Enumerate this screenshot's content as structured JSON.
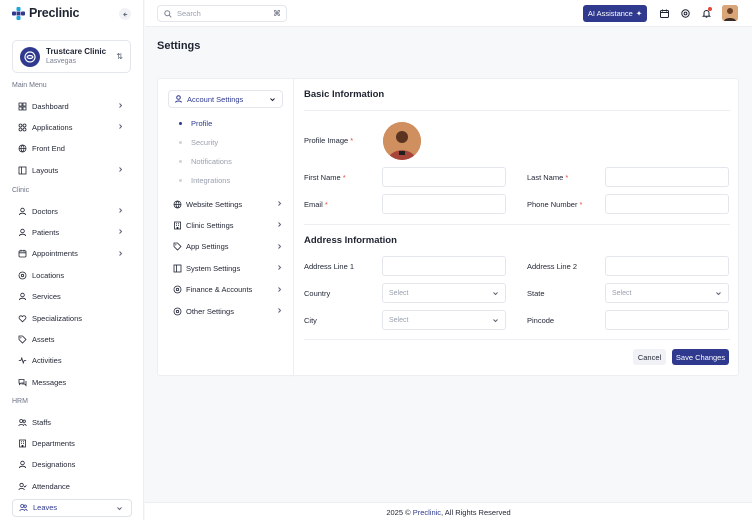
{
  "brand": {
    "name": "Preclinic",
    "primary_color": "#2f3a8f",
    "accent_color": "#1aa7e0"
  },
  "clinic": {
    "name": "Trustcare Clinic",
    "location": "Lasvegas"
  },
  "sidebar": {
    "sections": [
      {
        "title": "Main Menu",
        "items": [
          {
            "label": "Dashboard",
            "icon": "grid-icon",
            "has_children": true
          },
          {
            "label": "Applications",
            "icon": "apps-icon",
            "has_children": true
          },
          {
            "label": "Front End",
            "icon": "globe-icon",
            "has_children": false
          },
          {
            "label": "Layouts",
            "icon": "layout-icon",
            "has_children": true
          }
        ]
      },
      {
        "title": "Clinic",
        "items": [
          {
            "label": "Doctors",
            "icon": "user-icon",
            "has_children": true
          },
          {
            "label": "Patients",
            "icon": "user-icon",
            "has_children": true
          },
          {
            "label": "Appointments",
            "icon": "calendar-icon",
            "has_children": true
          },
          {
            "label": "Locations",
            "icon": "location-icon",
            "has_children": false
          },
          {
            "label": "Services",
            "icon": "user-icon",
            "has_children": false
          },
          {
            "label": "Specializations",
            "icon": "heart-icon",
            "has_children": false
          },
          {
            "label": "Assets",
            "icon": "tag-icon",
            "has_children": false
          },
          {
            "label": "Activities",
            "icon": "activity-icon",
            "has_children": false
          },
          {
            "label": "Messages",
            "icon": "chat-icon",
            "has_children": false
          }
        ]
      },
      {
        "title": "HRM",
        "items": [
          {
            "label": "Staffs",
            "icon": "users-icon",
            "has_children": false
          },
          {
            "label": "Departments",
            "icon": "building-icon",
            "has_children": false
          },
          {
            "label": "Designations",
            "icon": "user-icon",
            "has_children": false
          },
          {
            "label": "Attendance",
            "icon": "user-check-icon",
            "has_children": false
          },
          {
            "label": "Leaves",
            "icon": "users-icon",
            "has_children": true,
            "active": true
          }
        ]
      }
    ]
  },
  "topbar": {
    "search_placeholder": "Search",
    "shortcut": "⌘",
    "ai_label": "AI Assistance"
  },
  "page": {
    "title": "Settings"
  },
  "settings_nav": {
    "account": "Account Settings",
    "sub_items": [
      {
        "label": "Profile",
        "active": true
      },
      {
        "label": "Security",
        "active": false
      },
      {
        "label": "Notifications",
        "active": false
      },
      {
        "label": "Integrations",
        "active": false
      }
    ],
    "items": [
      "Website Settings",
      "Clinic Settings",
      "App Settings",
      "System Settings",
      "Finance & Accounts",
      "Other Settings"
    ]
  },
  "form": {
    "basic_title": "Basic Information",
    "profile_image": "Profile Image",
    "first_name": "First Name",
    "last_name": "Last Name",
    "email": "Email",
    "phone": "Phone Number",
    "address_title": "Address Information",
    "address1": "Address Line 1",
    "address2": "Address Line 2",
    "country": "Country",
    "state": "State",
    "city": "City",
    "pincode": "Pincode",
    "select_placeholder": "Select",
    "cancel": "Cancel",
    "save": "Save Changes"
  },
  "footer": {
    "year": "2025 ©",
    "brand": "Preclinic",
    "rights": ", All Rights Reserved"
  }
}
